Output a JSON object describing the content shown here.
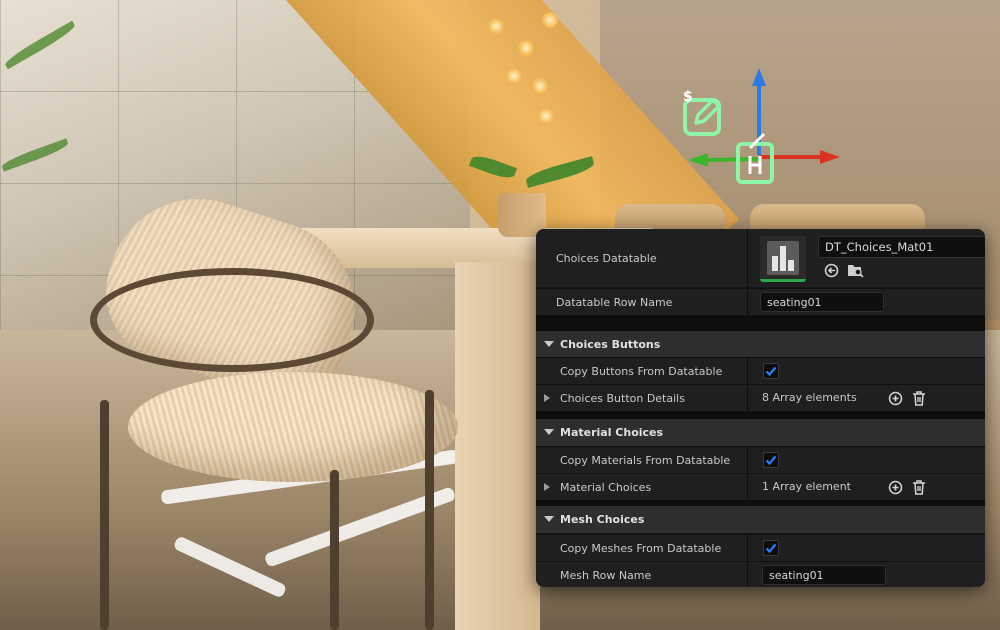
{
  "panel": {
    "datatable": {
      "label": "Choices Datatable",
      "asset_name": "DT_Choices_Mat01",
      "thumbnail_icon": "datatable-chart-icon",
      "browse_icon": "use-selected-arrow-icon",
      "find_icon": "browse-folder-icon"
    },
    "row_name": {
      "label": "Datatable Row Name",
      "value": "seating01"
    },
    "sections": {
      "buttons": {
        "title": "Choices Buttons",
        "copy_label": "Copy Buttons From Datatable",
        "copy_checked": true,
        "details_label": "Choices Button Details",
        "details_count": "8 Array elements"
      },
      "materials": {
        "title": "Material Choices",
        "copy_label": "Copy Materials From Datatable",
        "copy_checked": true,
        "details_label": "Material Choices",
        "details_count": "1 Array element"
      },
      "meshes": {
        "title": "Mesh Choices",
        "copy_label": "Copy Meshes From Datatable",
        "copy_checked": true,
        "row_label": "Mesh Row Name",
        "row_value": "seating01"
      }
    },
    "colors": {
      "panel_bg": "#151515",
      "row_bg": "#1f1f1f",
      "header_bg": "#2e2e2e",
      "check_blue": "#2a7fff",
      "thumb_underline": "#2aa84a"
    }
  },
  "gizmo": {
    "x_axis_color": "#d9341f",
    "y_axis_color": "#3bb52a",
    "z_axis_color": "#2c7be5",
    "overlay_color": "#8ff5a6",
    "edit_marker_glyph": "$",
    "icons": [
      "edit-marker-icon",
      "actor-anchor-icon"
    ]
  }
}
